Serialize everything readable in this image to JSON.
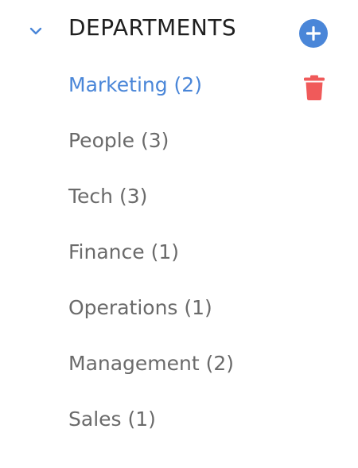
{
  "colors": {
    "accent": "#4a86d8",
    "selected": "#4a86d8",
    "delete": "#f05a5a",
    "text": "#6a6a6a",
    "title": "#1f1f1f"
  },
  "header": {
    "title": "DEPARTMENTS",
    "expanded": true,
    "toggle_icon": "chevron-down-icon",
    "add_icon": "plus-circle-icon"
  },
  "departments": [
    {
      "label": "Marketing (2)",
      "selected": true,
      "action_icon": "trash-icon"
    },
    {
      "label": "People (3)",
      "selected": false
    },
    {
      "label": "Tech (3)",
      "selected": false
    },
    {
      "label": "Finance (1)",
      "selected": false
    },
    {
      "label": "Operations (1)",
      "selected": false
    },
    {
      "label": "Management (2)",
      "selected": false
    },
    {
      "label": "Sales (1)",
      "selected": false
    }
  ]
}
